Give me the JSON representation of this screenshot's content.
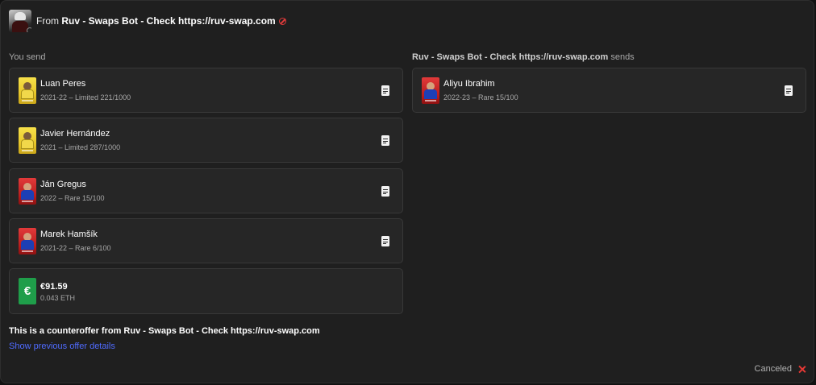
{
  "header": {
    "prefix": "From",
    "sender": "Ruv - Swaps Bot - Check https://ruv-swap.com"
  },
  "you_send": {
    "title": "You send",
    "items": [
      {
        "name": "Luan Peres",
        "meta": "2021-22 – Limited 221/1000",
        "tier": "limited"
      },
      {
        "name": "Javier Hernández",
        "meta": "2021 – Limited 287/1000",
        "tier": "limited"
      },
      {
        "name": "Ján Gregus",
        "meta": "2022 – Rare 15/100",
        "tier": "rare"
      },
      {
        "name": "Marek Hamšík",
        "meta": "2021-22 – Rare 6/100",
        "tier": "rare"
      }
    ],
    "money": {
      "symbol": "€",
      "amount": "€91.59",
      "eth": "0.043 ETH"
    }
  },
  "they_send": {
    "sender": "Ruv - Swaps Bot - Check https://ruv-swap.com",
    "suffix": "sends",
    "items": [
      {
        "name": "Aliyu Ibrahim",
        "meta": "2022-23 – Rare 15/100",
        "tier": "rare"
      }
    ]
  },
  "footer": {
    "counteroffer": "This is a counteroffer from Ruv - Swaps Bot - Check https://ruv-swap.com",
    "show_previous": "Show previous offer details",
    "status": "Canceled"
  },
  "colors": {
    "background": "#1f1f1f",
    "card": "#262626",
    "link": "#4f6bff",
    "cancel": "#e53935",
    "euro": "#1f9e4a"
  }
}
